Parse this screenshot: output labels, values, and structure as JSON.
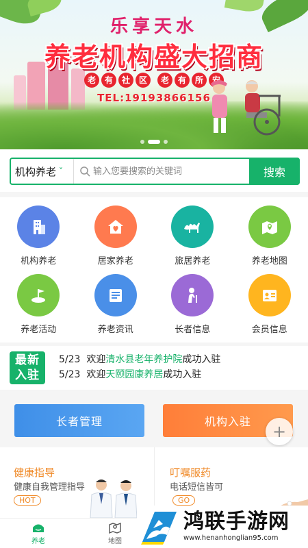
{
  "banner": {
    "title1": "乐享天水",
    "title2": "养老机构盛大招商",
    "tags": [
      [
        "老",
        "有",
        "社",
        "区"
      ],
      [
        "老",
        "有",
        "所",
        "安"
      ]
    ],
    "tel": "TEL:19193866156"
  },
  "search": {
    "category": "机构养老",
    "placeholder": "输入您要搜索的关键词",
    "button_label": "搜索"
  },
  "grid": [
    {
      "label": "机构养老",
      "icon": "building-icon",
      "color": "#5b83e6"
    },
    {
      "label": "居家养老",
      "icon": "home-heart-icon",
      "color": "#ff7a4f"
    },
    {
      "label": "旅居养老",
      "icon": "camel-icon",
      "color": "#19b3a1"
    },
    {
      "label": "养老地图",
      "icon": "map-pin-icon",
      "color": "#7ac943"
    },
    {
      "label": "养老活动",
      "icon": "flag-icon",
      "color": "#7ac943"
    },
    {
      "label": "养老资讯",
      "icon": "news-icon",
      "color": "#4a8fe8"
    },
    {
      "label": "长者信息",
      "icon": "elder-icon",
      "color": "#9b6ad6"
    },
    {
      "label": "会员信息",
      "icon": "member-card-icon",
      "color": "#ffb51f"
    }
  ],
  "news": {
    "badge_line1": "最新",
    "badge_line2": "入驻",
    "items": [
      {
        "date": "5/23",
        "prefix": "欢迎",
        "name": "清水县老年养护院",
        "suffix": "成功入驻"
      },
      {
        "date": "5/23",
        "prefix": "欢迎",
        "name": "天颐园康养居",
        "suffix": "成功入驻"
      }
    ]
  },
  "actions": {
    "elder": "长者管理",
    "institution": "机构入驻",
    "plus": "+"
  },
  "cards": {
    "left": {
      "title": "健康指导",
      "subtitle": "健康自我管理指导",
      "tag": "HOT"
    },
    "right": {
      "title": "叮嘱服药",
      "subtitle": "电话短信皆可",
      "tag": "GO"
    }
  },
  "nav": [
    {
      "label": "养老",
      "icon": "home-icon"
    },
    {
      "label": "地图",
      "icon": "map-icon"
    }
  ],
  "watermark": {
    "name": "鸿联手游网",
    "url": "www.henanhonglian95.com"
  }
}
